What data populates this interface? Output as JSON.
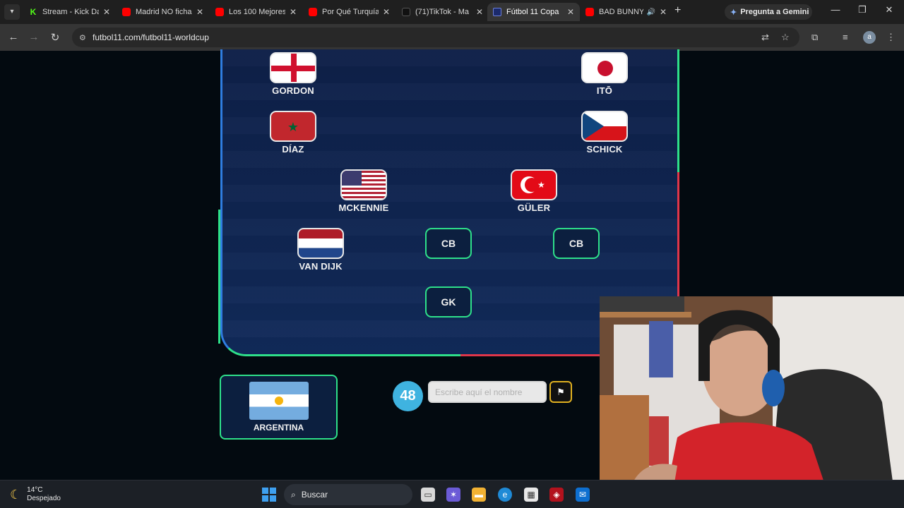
{
  "browser": {
    "tabs": [
      {
        "title": "Stream - Kick Da",
        "icon": "kick-icon",
        "active": false
      },
      {
        "title": "Madrid NO ficha",
        "icon": "youtube-icon",
        "active": false
      },
      {
        "title": "Los 100 Mejores",
        "icon": "youtube-icon",
        "active": false
      },
      {
        "title": "Por Qué Turquía",
        "icon": "youtube-icon",
        "active": false
      },
      {
        "title": "(71)TikTok - Ma",
        "icon": "tiktok-icon",
        "active": false
      },
      {
        "title": "Fútbol 11 Copa",
        "icon": "futbol11-icon",
        "active": true
      },
      {
        "title": "BAD BUNNY",
        "icon": "youtube-icon",
        "active": false
      }
    ],
    "gemini_label": "Pregunta a Gemini",
    "url": "futbol11.com/futbol11-worldcup"
  },
  "pitch": {
    "players": [
      {
        "name": "GORDON",
        "flag": "england"
      },
      {
        "name": "ITŌ",
        "flag": "japan"
      },
      {
        "name": "DÍAZ",
        "flag": "morocco"
      },
      {
        "name": "SCHICK",
        "flag": "czechia"
      },
      {
        "name": "MCKENNIE",
        "flag": "usa"
      },
      {
        "name": "GÜLER",
        "flag": "turkey"
      },
      {
        "name": "VAN DIJK",
        "flag": "netherlands"
      }
    ],
    "empty_slots": [
      "CB",
      "CB",
      "GK"
    ]
  },
  "game": {
    "team": "ARGENTINA",
    "counter": "48",
    "input_placeholder": "Escribe aquí el nombre",
    "input_value": ""
  },
  "taskbar": {
    "temperature": "14°C",
    "weather": "Despejado",
    "search_label": "Buscar"
  },
  "colors": {
    "pitch_bg": "#0f2551",
    "accent_green": "#2ee08a",
    "accent_red": "#e0364a",
    "counter_blue": "#3fb3e0"
  }
}
